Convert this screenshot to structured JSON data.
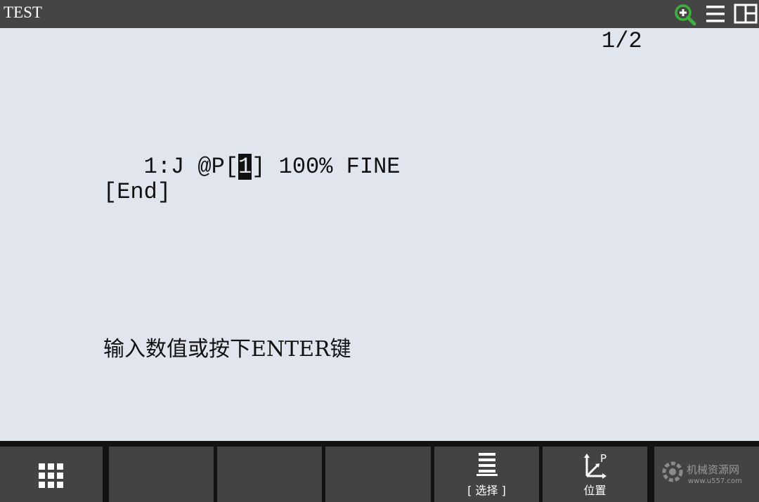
{
  "titlebar": {
    "title": "TEST",
    "icons": [
      "zoom-in-icon",
      "menu-icon",
      "split-view-icon"
    ],
    "zoom_icon_color": "#3bb33b"
  },
  "editor": {
    "page_indicator": "1/2",
    "line1_prefix": "   1:J @P[",
    "line1_cursor": "1",
    "line1_suffix": "] 100% FINE",
    "line2": "[End]"
  },
  "prompt": {
    "text": "输入数值或按下ENTER键"
  },
  "softkeys": {
    "f1": {
      "icon": "grid-menu-icon",
      "label": ""
    },
    "f2": {
      "label": ""
    },
    "f3": {
      "label": ""
    },
    "f4": {
      "label": ""
    },
    "f5": {
      "icon": "list-select-icon",
      "label": "[ 选择 ]"
    },
    "f6": {
      "icon": "position-axes-icon",
      "icon_letter": "P",
      "label": "位置"
    },
    "f7": {
      "watermark_title": "机械资源网",
      "watermark_url": "www.u557.com"
    }
  },
  "colors": {
    "background": "#e1e5ee",
    "titlebar": "#454545",
    "softkey": "#434343",
    "softkey_bar": "#121212"
  }
}
